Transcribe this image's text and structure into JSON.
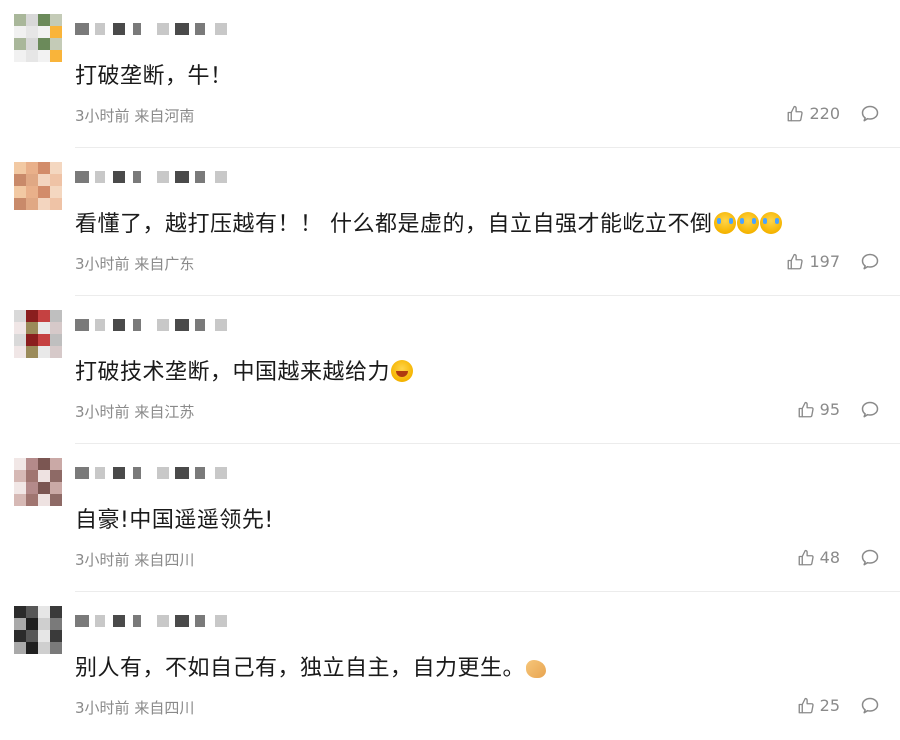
{
  "comments": [
    {
      "text": "打破垄断，牛！",
      "time": "3小时前",
      "location": "来自河南",
      "likes": "220",
      "avatar_colors": [
        "#a9b79a",
        "#d8d8d8",
        "#6b8a5a",
        "#c4cbb7",
        "#f1f1f1",
        "#e6e6e6",
        "#f2f2f2",
        "#f9b43a"
      ],
      "emojis": []
    },
    {
      "text": "看懂了，越打压越有！！ 什么都是虚的，自立自强才能屹立不倒",
      "time": "3小时前",
      "location": "来自广东",
      "likes": "197",
      "avatar_colors": [
        "#f2c9a3",
        "#e9b08a",
        "#d28c6a",
        "#f4d7c0",
        "#c98a6a",
        "#e0a884",
        "#f3d5bf",
        "#efc3a6"
      ],
      "emojis": [
        "cry-emoji",
        "cry-emoji",
        "cry-emoji"
      ]
    },
    {
      "text": "打破技术垄断，中国越来越给力",
      "time": "3小时前",
      "location": "来自江苏",
      "likes": "95",
      "avatar_colors": [
        "#d9d9d9",
        "#8a1e1e",
        "#c54141",
        "#bfbfbf",
        "#f0e6e6",
        "#9b8b5a",
        "#e9e9e9",
        "#d6c9c9"
      ],
      "emojis": [
        "laugh-emoji"
      ]
    },
    {
      "text": "自豪!中国遥遥领先!",
      "time": "3小时前",
      "location": "来自四川",
      "likes": "48",
      "avatar_colors": [
        "#f1e7e6",
        "#b48a8a",
        "#7b5652",
        "#caa9a6",
        "#d6b9b5",
        "#a07570",
        "#eee2e1",
        "#8e6a66"
      ],
      "emojis": []
    },
    {
      "text": "别人有，不如自己有，独立自主，自力更生。",
      "time": "3小时前",
      "location": "来自四川",
      "likes": "25",
      "avatar_colors": [
        "#2b2b2b",
        "#575757",
        "#e6e6e6",
        "#3a3a3a",
        "#a9a9a9",
        "#1f1f1f",
        "#cfcfcf",
        "#7a7a7a"
      ],
      "emojis": [
        "muscle-emoji"
      ]
    }
  ],
  "icons": {
    "like": "thumbs-up-icon",
    "reply": "comment-bubble-icon"
  },
  "colors": {
    "meta": "#8a8a8a",
    "divider": "#ececec"
  }
}
